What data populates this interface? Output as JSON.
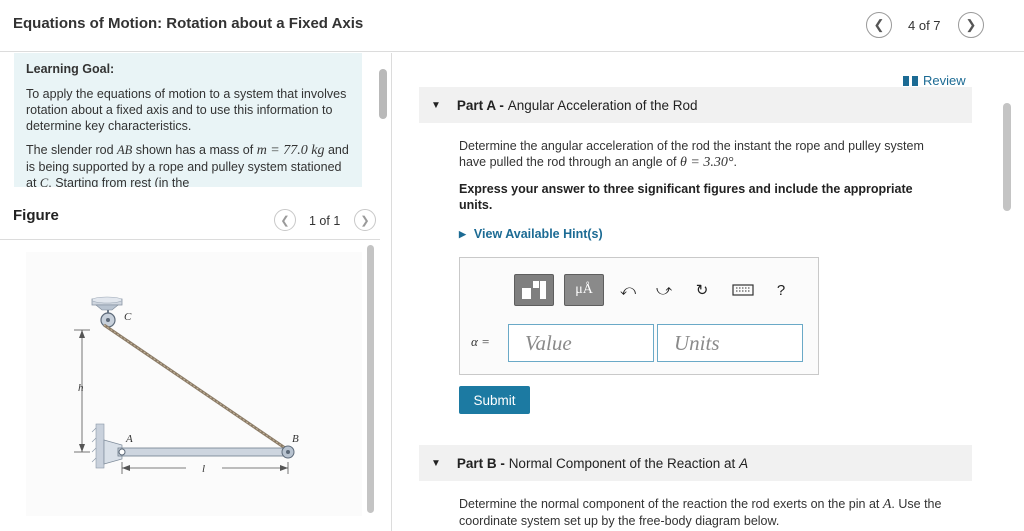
{
  "header": {
    "title": "Equations of Motion: Rotation about a Fixed Axis",
    "counter": "4 of 7",
    "prev_icon": "chevron-left-icon",
    "next_icon": "chevron-right-icon"
  },
  "learning_goal": {
    "title": "Learning Goal:",
    "para1": "To apply the equations of motion to a system that involves rotation about a fixed axis and to use this information to determine key characteristics.",
    "para2_prefix": "The slender rod ",
    "para2_rod": "AB",
    "para2_mid": " shown has a mass of ",
    "para2_mass": "m = 77.0 kg",
    "para2_suffix": " and is being supported by a rope and pulley system stationed at ",
    "para2_point": "C",
    "para2_tail": ". Starting from rest (in the"
  },
  "figure": {
    "title": "Figure",
    "counter": "1 of 1",
    "labels": {
      "C": "C",
      "h": "h",
      "A": "A",
      "B": "B",
      "l": "l"
    }
  },
  "review": {
    "label": "Review",
    "icon": "book-icon"
  },
  "part_a": {
    "prefix": "Part A - ",
    "title": "Angular Acceleration of the Rod",
    "question_line1": "Determine the angular acceleration of the rod the instant the rope and pulley system",
    "question_line2_prefix": "have pulled the rod through an angle of ",
    "question_theta": "θ = 3.30°",
    "question_line2_suffix": ".",
    "instructions": "Express your answer to three significant figures and include the appropriate units.",
    "hint_label": "View Available Hint(s)",
    "toolbar": {
      "templates_icon": "templates-icon",
      "units_label": "μÅ",
      "undo_icon": "undo-icon",
      "redo_icon": "redo-icon",
      "reset_icon": "reset-icon",
      "keyboard_icon": "keyboard-icon",
      "help_label": "?"
    },
    "variable_label": "α =",
    "value_placeholder": "Value",
    "units_placeholder": "Units",
    "submit_label": "Submit"
  },
  "part_b": {
    "prefix": "Part B - ",
    "title_prefix": "Normal Component of the Reaction at ",
    "title_point": "A",
    "question_prefix": "Determine the normal component of the reaction the rod exerts on the pin at ",
    "question_point": "A",
    "question_suffix": ". Use the",
    "question_line2": "coordinate system set up by the free-body diagram below."
  },
  "colors": {
    "accent": "#1c7aa2",
    "link": "#1c6b94",
    "goal_bg": "#e9f4f6"
  }
}
